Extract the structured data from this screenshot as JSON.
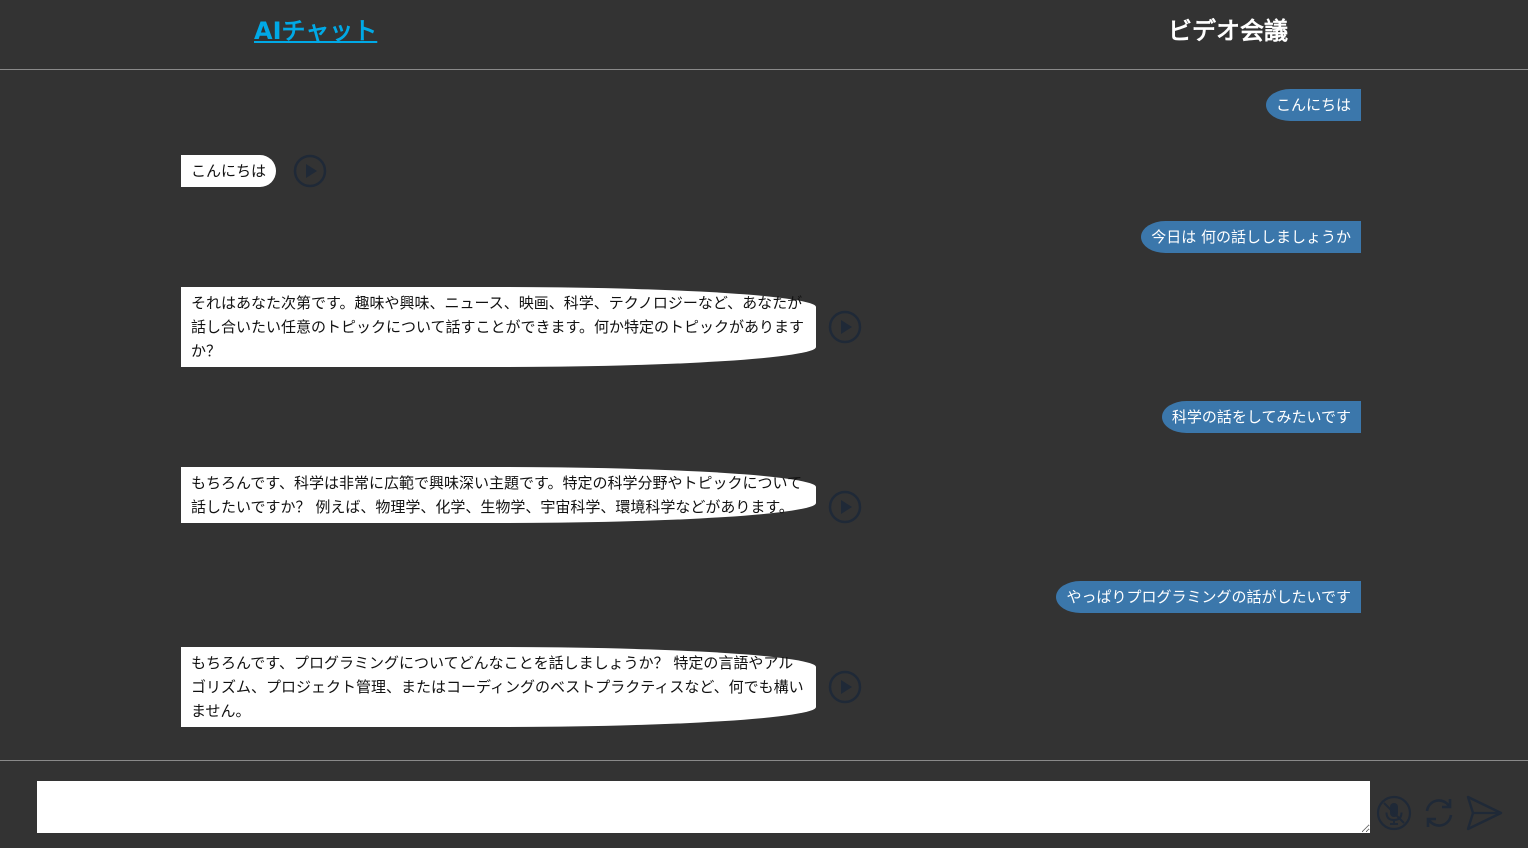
{
  "header": {
    "tab_ai_chat": "AIチャット",
    "tab_video_conference": "ビデオ会議"
  },
  "messages": [
    {
      "role": "user",
      "text": "こんにちは"
    },
    {
      "role": "ai",
      "text": "こんにちは"
    },
    {
      "role": "user",
      "text": "今日は 何の話ししましょうか"
    },
    {
      "role": "ai",
      "text": "それはあなた次第です。趣味や興味、ニュース、映画、科学、テクノロジーなど、あなたが話し合いたい任意のトピックについて話すことができます。何か特定のトピックがありますか？"
    },
    {
      "role": "user",
      "text": "科学の話をしてみたいです"
    },
    {
      "role": "ai",
      "text": "もちろんです、科学は非常に広範で興味深い主題です。特定の科学分野やトピックについて話したいですか？ 例えば、物理学、化学、生物学、宇宙科学、環境科学などがあります。"
    },
    {
      "role": "user",
      "text": "やっぱりプログラミングの話がしたいです"
    },
    {
      "role": "ai",
      "text": "もちろんです、プログラミングについてどんなことを話しましょうか？ 特定の言語やアルゴリズム、プロジェクト管理、またはコーディングのベストプラクティスなど、何でも構いません。"
    }
  ],
  "composer": {
    "input_value": "",
    "input_placeholder": ""
  },
  "icons": {
    "play": "play-circle-icon",
    "mic": "microphone-icon",
    "refresh": "refresh-icon",
    "send": "send-icon"
  },
  "colors": {
    "background": "#333333",
    "user_bubble": "#3b77ab",
    "ai_bubble": "#ffffff",
    "active_tab": "#00a9e6",
    "icon_dark": "#1f2937"
  }
}
